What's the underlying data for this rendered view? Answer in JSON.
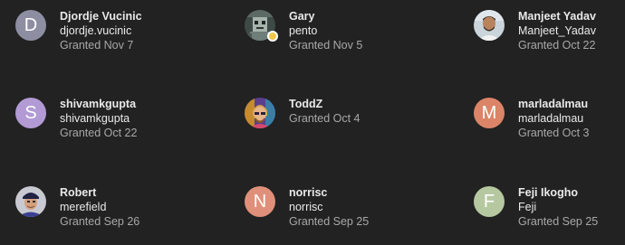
{
  "colors": {
    "background": "#222222",
    "name_text": "#e9e9e9",
    "granted_text": "#a8a8a8",
    "status_badge": "#f3c64a"
  },
  "users": [
    {
      "name": "Djordje Vucinic",
      "username": "djordje.vucinic",
      "granted": "Granted Nov 7",
      "avatar_letter": "D",
      "avatar_color": "#8e8ea2",
      "avatar_type": "letter"
    },
    {
      "name": "Gary",
      "username": "pento",
      "granted": "Granted Nov 5",
      "avatar_type": "photo",
      "avatar_icon": "pixel-art-avatar-icon",
      "status_icon": "status-emoji-icon"
    },
    {
      "name": "Manjeet Yadav",
      "username": "Manjeet_Yadav",
      "granted": "Granted Oct 22",
      "avatar_type": "photo",
      "avatar_icon": "person-photo-icon"
    },
    {
      "name": "shivamkgupta",
      "username": "shivamkgupta",
      "granted": "Granted Oct 22",
      "avatar_letter": "S",
      "avatar_color": "#b29ad4",
      "avatar_type": "letter"
    },
    {
      "name": "ToddZ",
      "username": "",
      "granted": "Granted Oct 4",
      "avatar_type": "photo",
      "avatar_icon": "illustrated-portrait-icon"
    },
    {
      "name": "marladalmau",
      "username": "marladalmau",
      "granted": "Granted Oct 3",
      "avatar_letter": "M",
      "avatar_color": "#dc8468",
      "avatar_type": "letter"
    },
    {
      "name": "Robert",
      "username": "merefield",
      "granted": "Granted Sep 26",
      "avatar_type": "photo",
      "avatar_icon": "person-cap-photo-icon"
    },
    {
      "name": "norrisc",
      "username": "norrisc",
      "granted": "Granted Sep 25",
      "avatar_letter": "N",
      "avatar_color": "#e0907a",
      "avatar_type": "letter"
    },
    {
      "name": "Feji Ikogho",
      "username": "Feji",
      "granted": "Granted Sep 25",
      "avatar_letter": "F",
      "avatar_color": "#b6c8a0",
      "avatar_type": "letter"
    }
  ]
}
